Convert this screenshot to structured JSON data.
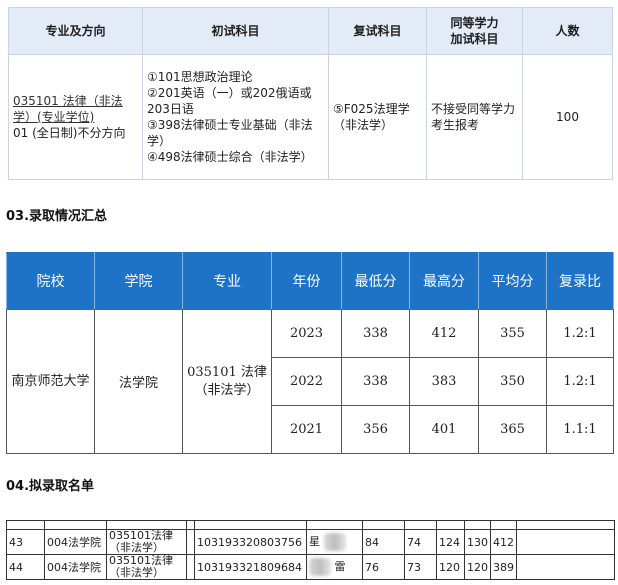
{
  "table1": {
    "headers": [
      "专业及方向",
      "初试科目",
      "复试科目",
      "同等学力\n加试科目",
      "人数"
    ],
    "row": {
      "major_code_name": "035101 法律（非法学）(专业学位)",
      "direction": "01 (全日制)不分方向",
      "exams": [
        "①101思想政治理论",
        "②201英语（一）或202俄语或203日语",
        "③398法律硕士专业基础（非法学）",
        "④498法律硕士综合（非法学）"
      ],
      "retest": "⑤F025法理学（非法学）",
      "equivalent": "不接受同等学力考生报考",
      "count": "100"
    }
  },
  "section3": {
    "title": "03.录取情况汇总"
  },
  "table2": {
    "headers": [
      "院校",
      "学院",
      "专业",
      "年份",
      "最低分",
      "最高分",
      "平均分",
      "复录比"
    ],
    "school": "南京师范大学",
    "college": "法学院",
    "major": "035101 法律（非法学）",
    "rows": [
      {
        "year": "2023",
        "min": "338",
        "max": "412",
        "avg": "355",
        "ratio": "1.2:1"
      },
      {
        "year": "2022",
        "min": "338",
        "max": "383",
        "avg": "350",
        "ratio": "1.2:1"
      },
      {
        "year": "2021",
        "min": "356",
        "max": "401",
        "avg": "365",
        "ratio": "1.1:1"
      }
    ]
  },
  "chart_data": {
    "type": "table",
    "columns": [
      "年份",
      "最低分",
      "最高分",
      "平均分",
      "复录比"
    ],
    "rows": [
      [
        "2023",
        338,
        412,
        355,
        "1.2:1"
      ],
      [
        "2022",
        338,
        383,
        350,
        "1.2:1"
      ],
      [
        "2021",
        356,
        401,
        365,
        "1.1:1"
      ]
    ]
  },
  "section4": {
    "title": "04.拟录取名单"
  },
  "table3": {
    "rows": [
      {
        "no": "43",
        "college": "004法学院",
        "major": "035101法律（非法学）",
        "id": "103193320803756",
        "name_partial": "星",
        "s1": "84",
        "s2": "74",
        "s3": "124",
        "s4": "130",
        "total": "412"
      },
      {
        "no": "44",
        "college": "004法学院",
        "major": "035101法律（非法学）",
        "id": "103193321809684",
        "name_partial": "雷",
        "s1": "76",
        "s2": "73",
        "s3": "120",
        "s4": "120",
        "total": "389"
      }
    ]
  }
}
